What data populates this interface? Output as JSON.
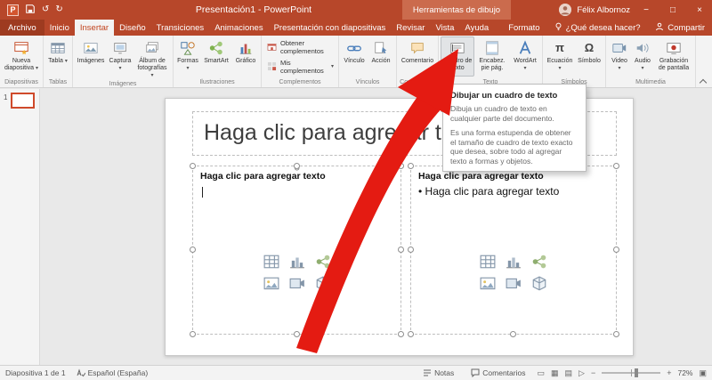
{
  "icons": {
    "caret": "▾",
    "undo": "↺",
    "redo": "↻",
    "minimize": "−",
    "maximize": "□",
    "close": "×",
    "pi": "π",
    "omega": "Ω",
    "bullet": "•",
    "rotate": "↻",
    "logo_letter": "P",
    "view_normal": "▭",
    "view_sorter": "▦",
    "view_reading": "▤",
    "view_slideshow": "▷",
    "zoom_out": "−",
    "zoom_in": "+",
    "fit": "▣"
  },
  "titlebar": {
    "title": "Presentación1 - PowerPoint",
    "context_header": "Herramientas de dibujo",
    "user": "Félix Albornoz"
  },
  "tabs": {
    "items": [
      {
        "label": "Archivo"
      },
      {
        "label": "Inicio"
      },
      {
        "label": "Insertar"
      },
      {
        "label": "Diseño"
      },
      {
        "label": "Transiciones"
      },
      {
        "label": "Animaciones"
      },
      {
        "label": "Presentación con diapositivas"
      },
      {
        "label": "Revisar"
      },
      {
        "label": "Vista"
      },
      {
        "label": "Ayuda"
      },
      {
        "label": "Formato"
      }
    ],
    "search_label": "¿Qué desea hacer?",
    "share_label": "Compartir"
  },
  "ribbon": {
    "groups": [
      {
        "name": "Diapositivas",
        "buttons": [
          {
            "label": "Nueva diapositiva"
          }
        ]
      },
      {
        "name": "Tablas",
        "buttons": [
          {
            "label": "Tabla"
          }
        ]
      },
      {
        "name": "Imágenes",
        "buttons": [
          {
            "label": "Imágenes"
          },
          {
            "label": "Captura"
          },
          {
            "label": "Álbum de fotografías"
          }
        ]
      },
      {
        "name": "Ilustraciones",
        "buttons": [
          {
            "label": "Formas"
          },
          {
            "label": "SmartArt"
          },
          {
            "label": "Gráfico"
          }
        ]
      },
      {
        "name": "Complementos",
        "buttons": [
          {
            "label": "Obtener complementos"
          },
          {
            "label": "Mis complementos"
          }
        ]
      },
      {
        "name": "Vínculos",
        "buttons": [
          {
            "label": "Vínculo"
          },
          {
            "label": "Acción"
          }
        ]
      },
      {
        "name": "Comentarios",
        "buttons": [
          {
            "label": "Comentario"
          }
        ]
      },
      {
        "name": "Texto",
        "buttons": [
          {
            "label": "Cuadro de texto"
          },
          {
            "label": "Encabez. pie pág."
          },
          {
            "label": "WordArt"
          }
        ]
      },
      {
        "name": "Símbolos",
        "buttons": [
          {
            "label": "Ecuación"
          },
          {
            "label": "Símbolo"
          }
        ]
      },
      {
        "name": "Multimedia",
        "buttons": [
          {
            "label": "Video"
          },
          {
            "label": "Audio"
          },
          {
            "label": "Grabación de pantalla"
          }
        ]
      }
    ]
  },
  "tooltip": {
    "title": "Dibujar un cuadro de texto",
    "body1": "Dibuja un cuadro de texto en cualquier parte del documento.",
    "body2": "Es una forma estupenda de obtener el tamaño de cuadro de texto exacto que desea, sobre todo al agregar texto a formas y objetos."
  },
  "panel": {
    "slide_number": "1"
  },
  "slide": {
    "title_prompt": "Haga clic para agregar título",
    "left_heading": "Haga clic para agregar texto",
    "right_heading": "Haga clic para agregar texto",
    "right_bullet": "Haga clic para agregar texto"
  },
  "statusbar": {
    "slide_info": "Diapositiva 1 de 1",
    "language": "Español (España)",
    "notes": "Notas",
    "comments": "Comentarios",
    "zoom": "72%"
  }
}
